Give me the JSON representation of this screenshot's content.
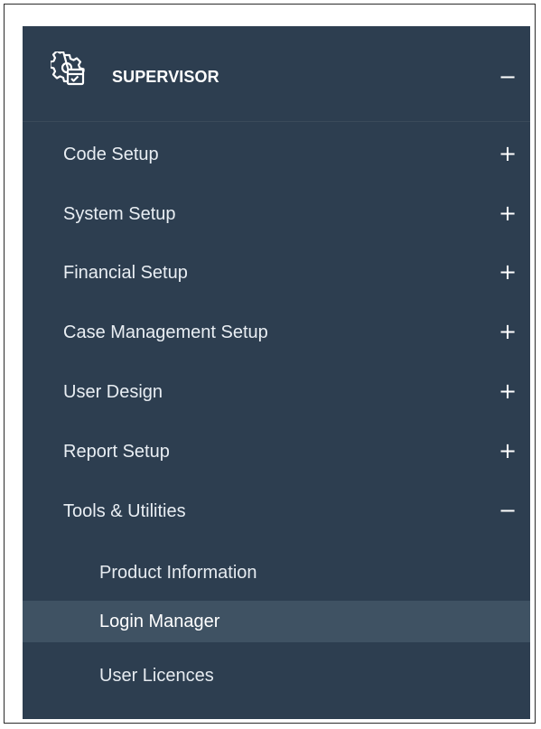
{
  "menu": {
    "header": {
      "title": "SUPERVISOR",
      "toggle": "−",
      "icon": "gear-checklist-icon"
    },
    "items": [
      {
        "label": "Code Setup",
        "toggle": "+"
      },
      {
        "label": "System Setup",
        "toggle": "+"
      },
      {
        "label": "Financial Setup",
        "toggle": "+"
      },
      {
        "label": "Case Management Setup",
        "toggle": "+"
      },
      {
        "label": "User Design",
        "toggle": "+"
      },
      {
        "label": "Report Setup",
        "toggle": "+"
      },
      {
        "label": "Tools & Utilities",
        "toggle": "−"
      }
    ],
    "subitems": [
      {
        "label": "Product Information"
      },
      {
        "label": "Login Manager",
        "active": true
      },
      {
        "label": "User Licences"
      }
    ]
  },
  "colors": {
    "panel_bg": "#2d3e50",
    "active_bg": "#3f5263",
    "text": "#ffffff"
  }
}
